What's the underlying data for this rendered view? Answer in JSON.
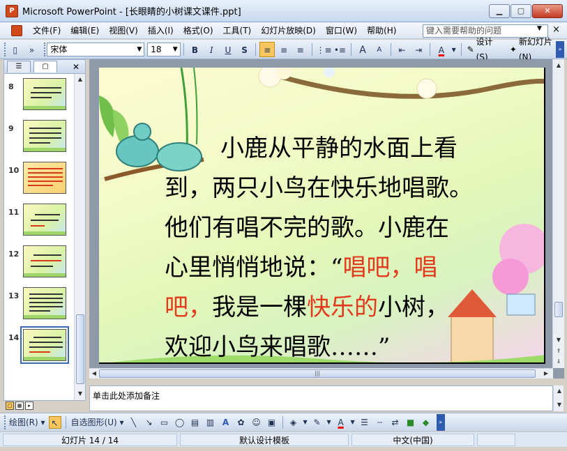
{
  "window": {
    "title": "Microsoft PowerPoint - [长眼睛的小树课文课件.ppt]",
    "min_symbol": "▁",
    "max_symbol": "▢",
    "close_symbol": "✕"
  },
  "menu": {
    "items": [
      "文件(F)",
      "编辑(E)",
      "视图(V)",
      "插入(I)",
      "格式(O)",
      "工具(T)",
      "幻灯片放映(D)",
      "窗口(W)",
      "帮助(H)"
    ],
    "help_placeholder": "键入需要帮助的问题",
    "close_symbol": "×"
  },
  "format_toolbar": {
    "font_name": "宋体",
    "font_size": "18",
    "bold": "B",
    "italic": "I",
    "underline": "U",
    "shadow": "S",
    "align_left_active": true,
    "design_label": "设计(S)",
    "new_slide_label": "新幻灯片(N)",
    "font_grow": "A",
    "font_shrink": "A"
  },
  "slides_pane": {
    "thumbnails": [
      {
        "number": "8"
      },
      {
        "number": "9"
      },
      {
        "number": "10"
      },
      {
        "number": "11"
      },
      {
        "number": "12"
      },
      {
        "number": "13"
      },
      {
        "number": "14",
        "selected": true
      }
    ]
  },
  "slide": {
    "line1": "小鹿从平静的水面上看",
    "line2": "到，两只小鸟在快乐地唱歌。",
    "line3": "他们有唱不完的歌。小鹿在",
    "line4_a": "心里悄悄地说：“",
    "line4_b": "唱吧，唱",
    "line5_a": "吧，",
    "line5_b": "我是一棵",
    "line5_c": "快乐的",
    "line5_d": "小树，",
    "line6": "欢迎小鸟来唱歌……”",
    "highlight_color": "#e23a1c"
  },
  "notes": {
    "placeholder": "单击此处添加备注"
  },
  "drawing_toolbar": {
    "draw_label": "绘图(R)",
    "autoshapes_label": "自选图形(U)"
  },
  "status": {
    "slide_position": "幻灯片 14 / 14",
    "design_template": "默认设计模板",
    "language": "中文(中国)"
  }
}
